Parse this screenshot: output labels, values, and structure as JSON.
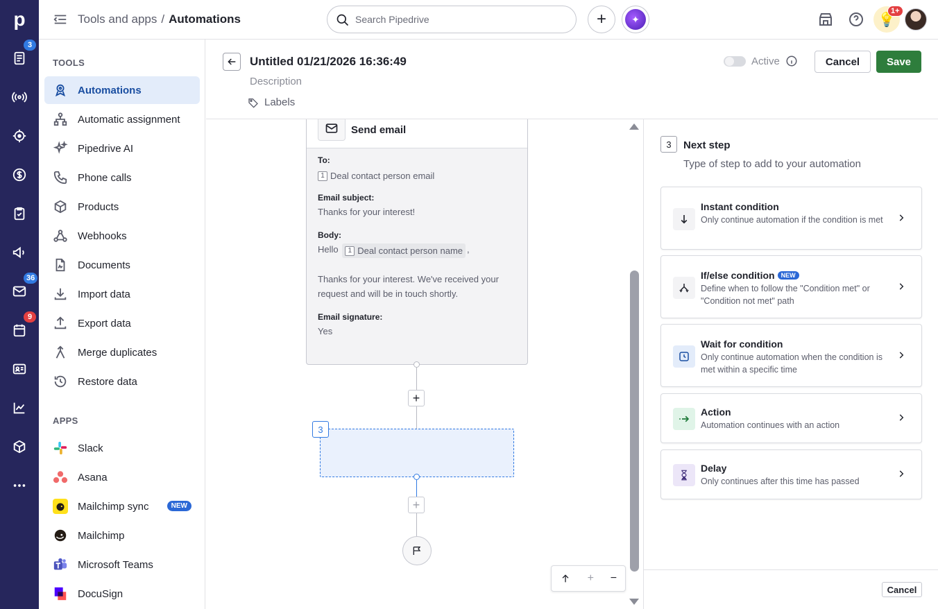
{
  "topbar": {
    "breadcrumb_parent": "Tools and apps",
    "breadcrumb_separator": "/",
    "breadcrumb_current": "Automations",
    "search_placeholder": "Search Pipedrive",
    "notification_badge": "1+"
  },
  "rail": {
    "logo": "p",
    "badges": {
      "activities": "3",
      "mail": "36",
      "calendar": "9"
    }
  },
  "sidenav": {
    "tools_heading": "TOOLS",
    "tools": [
      {
        "label": "Automations",
        "icon": "automation-icon",
        "active": true
      },
      {
        "label": "Automatic assignment",
        "icon": "assignment-icon"
      },
      {
        "label": "Pipedrive AI",
        "icon": "sparkle-icon"
      },
      {
        "label": "Phone calls",
        "icon": "phone-icon"
      },
      {
        "label": "Products",
        "icon": "box-icon"
      },
      {
        "label": "Webhooks",
        "icon": "webhook-icon"
      },
      {
        "label": "Documents",
        "icon": "document-icon"
      },
      {
        "label": "Import data",
        "icon": "download-icon"
      },
      {
        "label": "Export data",
        "icon": "upload-icon"
      },
      {
        "label": "Merge duplicates",
        "icon": "merge-icon"
      },
      {
        "label": "Restore data",
        "icon": "restore-icon"
      }
    ],
    "apps_heading": "APPS",
    "apps": [
      {
        "label": "Slack",
        "icon": "slack-logo"
      },
      {
        "label": "Asana",
        "icon": "asana-logo"
      },
      {
        "label": "Mailchimp sync",
        "icon": "mailchimp-logo",
        "badge": "NEW"
      },
      {
        "label": "Mailchimp",
        "icon": "mailchimp-logo"
      },
      {
        "label": "Microsoft Teams",
        "icon": "teams-logo"
      },
      {
        "label": "DocuSign",
        "icon": "docusign-logo"
      }
    ]
  },
  "editor": {
    "title": "Untitled 01/21/2026 16:36:49",
    "description_placeholder": "Description",
    "labels": "Labels",
    "active_label": "Active",
    "cancel": "Cancel",
    "save": "Save"
  },
  "email_step": {
    "title": "Send email",
    "to_label": "To:",
    "to_chip_num": "1",
    "to_value": "Deal contact person email",
    "subject_label": "Email subject:",
    "subject_value": "Thanks for your interest!",
    "body_label": "Body:",
    "body_hello": "Hello",
    "body_chip_num": "1",
    "body_chip": "Deal contact person name",
    "body_comma": ",",
    "body_text": "Thanks for your interest. We've received your request and will be in touch shortly.",
    "signature_label": "Email signature:",
    "signature_value": "Yes"
  },
  "canvas": {
    "placeholder_step_num": "3"
  },
  "panel": {
    "step_num": "3",
    "title": "Next step",
    "subtitle": "Type of step to add to your automation",
    "options": [
      {
        "title": "Instant condition",
        "desc": "Only continue automation if the condition is met",
        "icon": "arrow-down-icon",
        "color": "#f3f3f5"
      },
      {
        "title": "If/else condition",
        "badge": "NEW",
        "desc": "Define when to follow the \"Condition met\" or \"Condition not met\" path",
        "icon": "branch-icon",
        "color": "#f3f3f5"
      },
      {
        "title": "Wait for condition",
        "desc": "Only continue automation when the condition is met within a specific time",
        "icon": "clock-icon",
        "color": "#e3ecfa"
      },
      {
        "title": "Action",
        "desc": "Automation continues with an action",
        "icon": "action-arrow-icon",
        "color": "#e0f4e8"
      },
      {
        "title": "Delay",
        "desc": "Only continues after this time has passed",
        "icon": "hourglass-icon",
        "color": "#ece6f8"
      }
    ],
    "cancel": "Cancel"
  }
}
